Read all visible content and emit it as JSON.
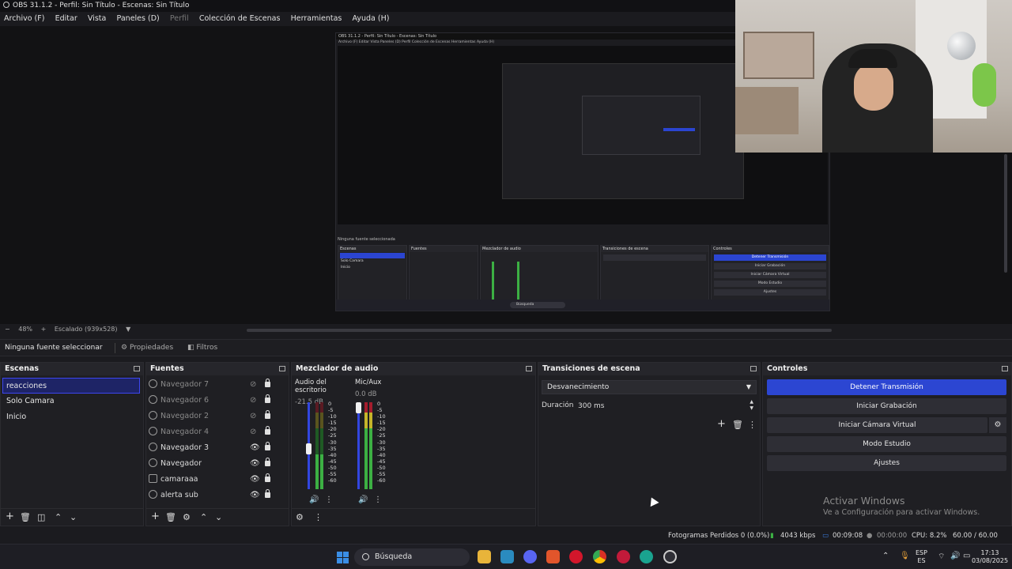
{
  "window": {
    "title": "OBS 31.1.2 - Perfil: Sin Título - Escenas: Sin Título"
  },
  "menu": [
    "Archivo (F)",
    "Editar",
    "Vista",
    "Paneles (D)",
    "Perfil",
    "Colección de Escenas",
    "Herramientas",
    "Ayuda (H)"
  ],
  "preview": {
    "zoom": "48%",
    "scaling": "Escalado (939x528)",
    "nested_title": "OBS 31.1.2 - Perfil: Sin Título - Escenas: Sin Título",
    "nested_menu": "Archivo (F)   Editar   Vista   Paneles (D)   Perfil   Colección de Escenas   Herramientas   Ayuda (H)",
    "nested_sources_label": "Ninguna fuente seleccionada",
    "nested_search": "Búsqueda",
    "nested_headers": [
      "Escenas",
      "Fuentes",
      "Mezclador de audio",
      "Transiciones de escena",
      "Controles"
    ],
    "nested_scenes": [
      "reacciones",
      "Solo Camara",
      "Inicio"
    ],
    "nested_controls": [
      "Detener Transmisión",
      "Iniciar Grabación",
      "Iniciar Cámara Virtual",
      "Modo Estudio",
      "Ajustes"
    ]
  },
  "source_bar": {
    "none_selected": "Ninguna fuente seleccionar",
    "properties": "Propiedades",
    "filters": "Filtros"
  },
  "scenes": {
    "header": "Escenas",
    "items": [
      "reacciones",
      "Solo Camara",
      "Inicio"
    ],
    "selected_index": 0
  },
  "sources": {
    "header": "Fuentes",
    "items": [
      {
        "name": "Navegador 7",
        "visible": false,
        "icon": "browser-icon"
      },
      {
        "name": "Navegador 6",
        "visible": false,
        "icon": "browser-icon"
      },
      {
        "name": "Navegador 2",
        "visible": false,
        "icon": "browser-icon"
      },
      {
        "name": "Navegador 4",
        "visible": false,
        "icon": "browser-icon"
      },
      {
        "name": "Navegador 3",
        "visible": true,
        "icon": "browser-icon"
      },
      {
        "name": "Navegador",
        "visible": true,
        "icon": "browser-icon"
      },
      {
        "name": "camaraaa",
        "visible": true,
        "icon": "camera-icon"
      },
      {
        "name": "alerta sub",
        "visible": true,
        "icon": "browser-icon"
      }
    ]
  },
  "mixer": {
    "header": "Mezclador de audio",
    "channels": [
      {
        "name": "Audio del escritorio",
        "db": "-21.5 dB"
      },
      {
        "name": "Mic/Aux",
        "db": "0.0 dB"
      }
    ],
    "scale": [
      "0",
      "-5",
      "-10",
      "-15",
      "-20",
      "-25",
      "-30",
      "-35",
      "-40",
      "-45",
      "-50",
      "-55",
      "-60"
    ]
  },
  "transitions": {
    "header": "Transiciones de escena",
    "selected": "Desvanecimiento",
    "duration_label": "Duración",
    "duration_value": "300 ms"
  },
  "controls": {
    "header": "Controles",
    "stop_stream": "Detener Transmisión",
    "start_record": "Iniciar Grabación",
    "virtual_cam": "Iniciar Cámara Virtual",
    "studio_mode": "Modo Estudio",
    "settings": "Ajustes"
  },
  "watermark": {
    "line1": "Activar Windows",
    "line2": "Ve a Configuración para activar Windows."
  },
  "status": {
    "dropped": "Fotogramas Perdidos 0 (0.0%)",
    "bitrate": "4043 kbps",
    "stream_time": "00:09:08",
    "rec_time": "00:00:00",
    "cpu": "CPU: 8.2%",
    "fps": "60.00 / 60.00 FPS"
  },
  "taskbar": {
    "search": "Búsqueda",
    "lang1": "ESP",
    "lang2": "ES",
    "time": "17:13",
    "date": "03/08/2025"
  },
  "colors": {
    "accent": "#2c46d2",
    "background": "#1b1b1f",
    "panel": "#1f1f23"
  }
}
